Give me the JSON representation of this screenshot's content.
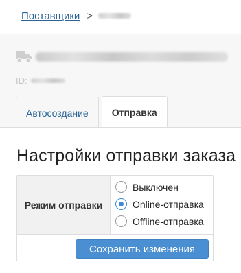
{
  "breadcrumb": {
    "parent_link": "Поставщики",
    "separator": ">"
  },
  "supplier": {
    "icon": "truck-icon",
    "id_label": "ID:"
  },
  "tabs": [
    {
      "label": "Автосоздание",
      "active": false
    },
    {
      "label": "Отправка",
      "active": true
    }
  ],
  "settings": {
    "title": "Настройки отправки заказа",
    "mode_label": "Режим отправки",
    "options": [
      {
        "label": "Выключен",
        "checked": false
      },
      {
        "label": "Online-отправка",
        "checked": true
      },
      {
        "label": "Offline-отправка",
        "checked": false
      }
    ],
    "save_label": "Сохранить изменения"
  },
  "colors": {
    "link": "#2a6496",
    "accent": "#4a8fd1",
    "header_bg": "#f7f7f7"
  }
}
